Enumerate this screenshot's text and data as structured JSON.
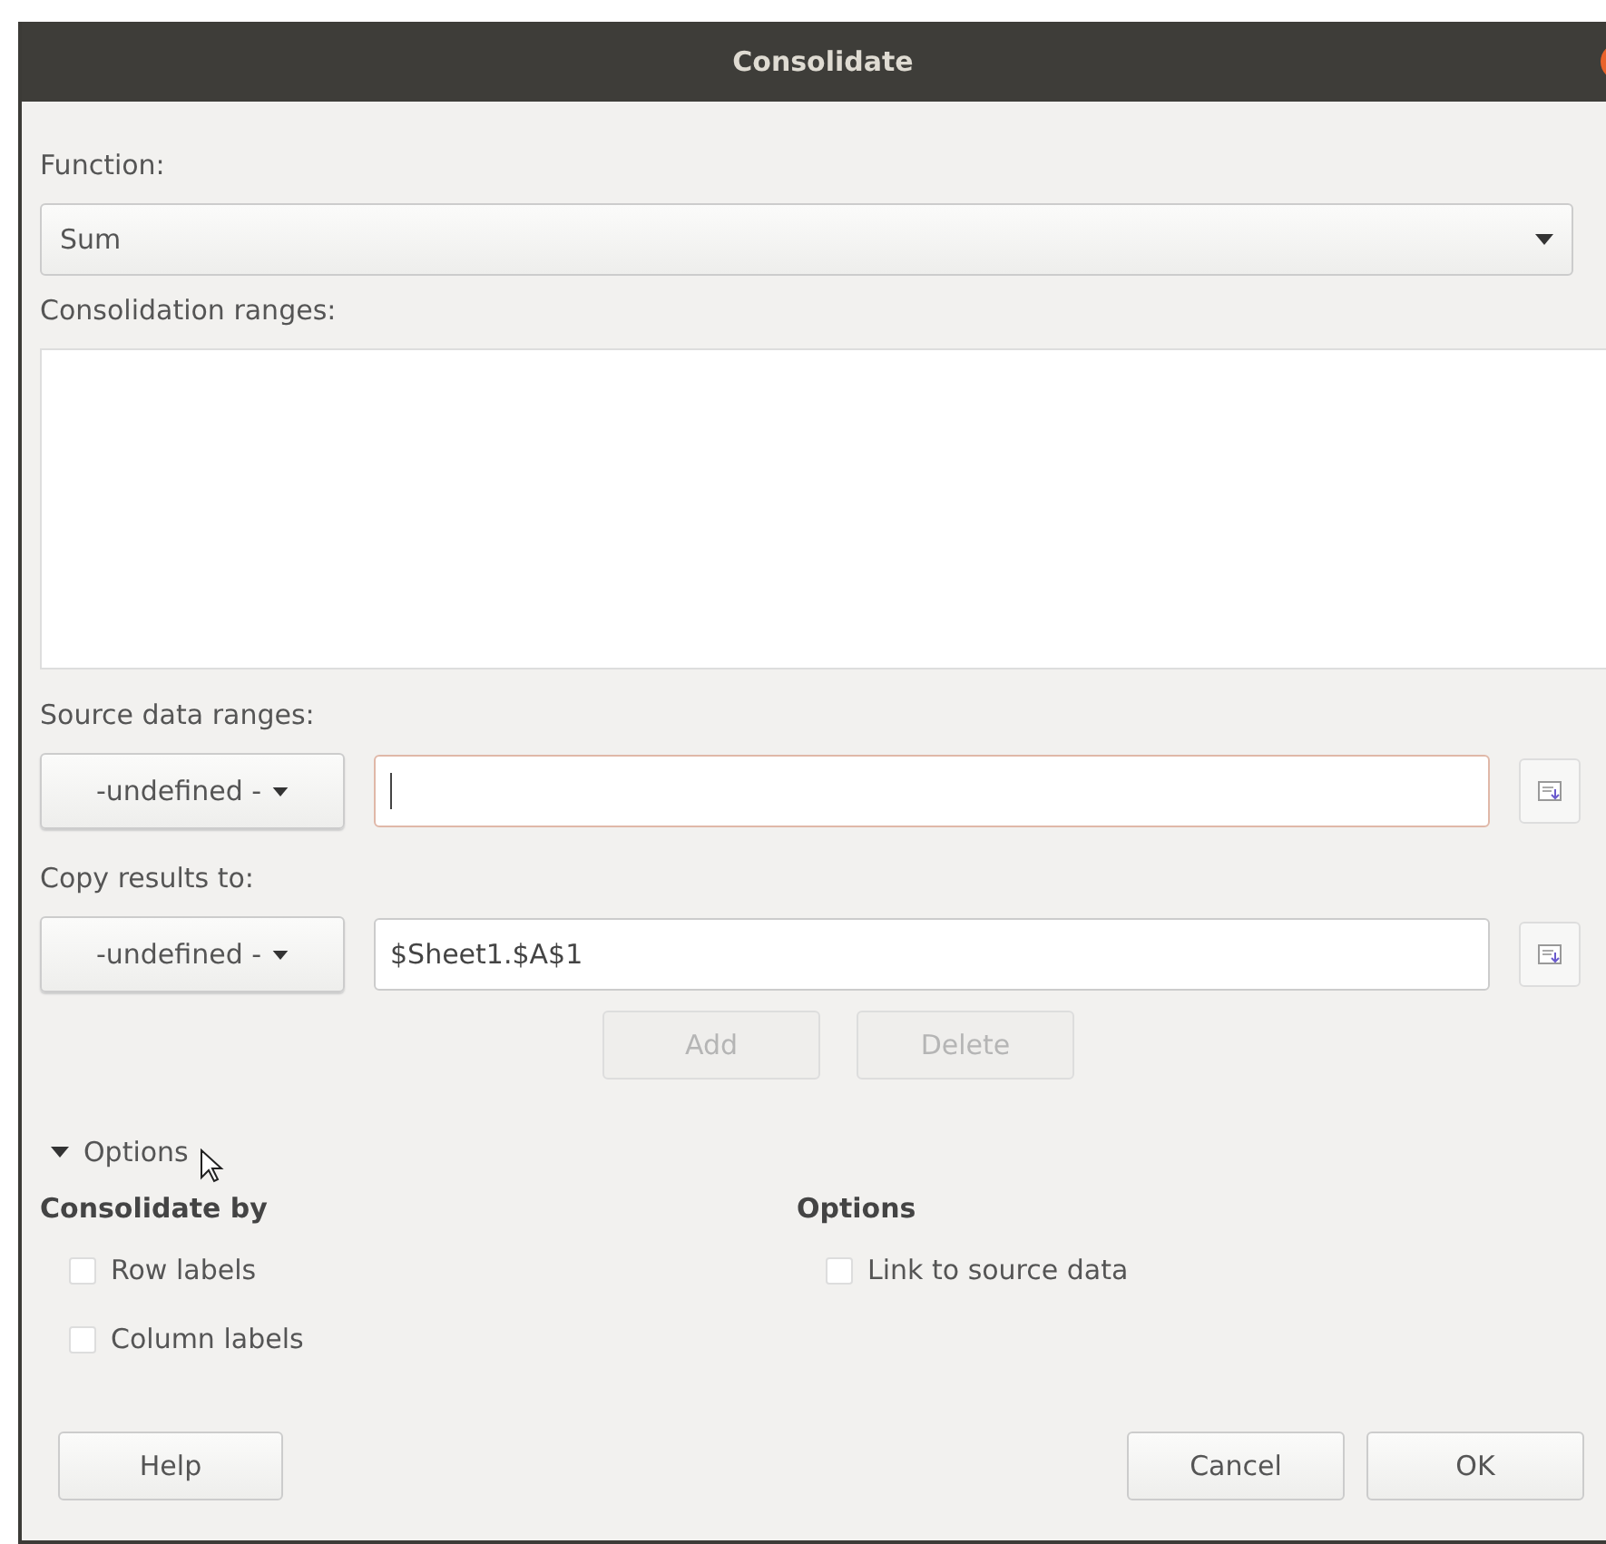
{
  "window": {
    "title": "Consolidate"
  },
  "function": {
    "label": "Function:",
    "value": "Sum"
  },
  "consolidation_ranges": {
    "label": "Consolidation ranges:"
  },
  "source": {
    "label": "Source data ranges:",
    "dropdown": "-undefined -"
  },
  "copy_to": {
    "label": "Copy results to:",
    "dropdown": "-undefined -",
    "value": "$Sheet1.$A$1"
  },
  "range_buttons": [
    {
      "label": "Add",
      "disabled": true
    },
    {
      "label": "Delete",
      "disabled": true
    }
  ],
  "options": {
    "label": "Options",
    "expanded": true
  },
  "groups": [
    {
      "title": "Consolidate by",
      "items": [
        {
          "label": "Row labels",
          "checked": false
        },
        {
          "label": "Column labels",
          "checked": false
        }
      ]
    },
    {
      "title": "Options",
      "items": [
        {
          "label": "Link to source data",
          "checked": false
        }
      ]
    }
  ],
  "buttons": [
    {
      "label": "Help",
      "kind": "help"
    },
    {
      "label": "Cancel",
      "kind": "action"
    },
    {
      "label": "OK",
      "kind": "action"
    }
  ]
}
